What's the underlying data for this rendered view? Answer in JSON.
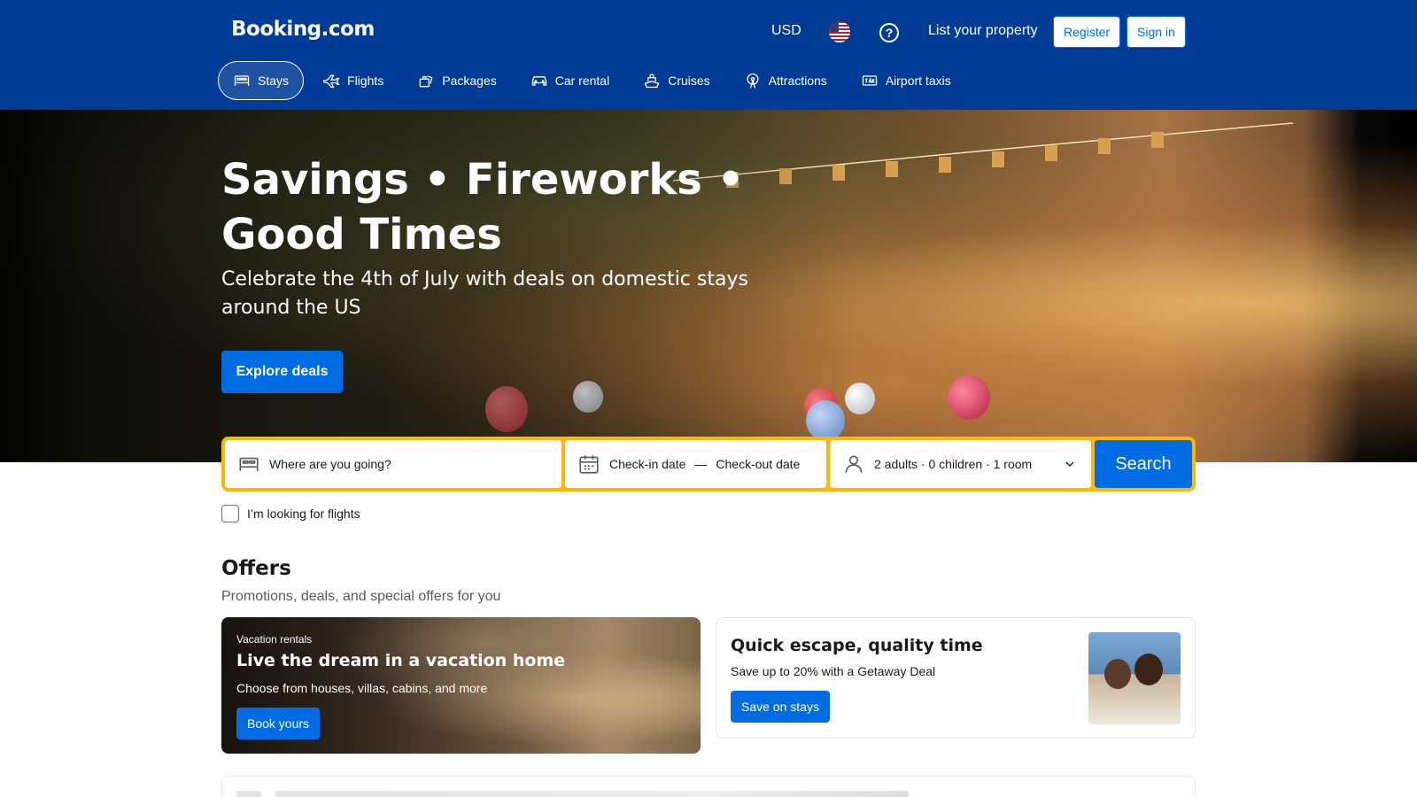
{
  "header": {
    "logo": "Booking.com",
    "currency": "USD",
    "list_property": "List your property",
    "register": "Register",
    "sign_in": "Sign in"
  },
  "nav": {
    "items": [
      {
        "label": "Stays",
        "icon": "bed-icon",
        "active": true
      },
      {
        "label": "Flights",
        "icon": "plane-icon"
      },
      {
        "label": "Packages",
        "icon": "packages-icon"
      },
      {
        "label": "Car rental",
        "icon": "car-icon"
      },
      {
        "label": "Cruises",
        "icon": "ship-icon"
      },
      {
        "label": "Attractions",
        "icon": "ferris-wheel-icon"
      },
      {
        "label": "Airport taxis",
        "icon": "taxi-icon"
      }
    ]
  },
  "hero": {
    "title": "Savings • Fireworks • Good Times",
    "subtitle": "Celebrate the 4th of July with deals on domestic stays around the US",
    "cta": "Explore deals"
  },
  "search": {
    "destination_placeholder": "Where are you going?",
    "checkin": "Check-in date",
    "separator": "—",
    "checkout": "Check-out date",
    "guests": "2 adults · 0 children · 1 room",
    "button": "Search"
  },
  "flights_checkbox": "I’m looking for flights",
  "offers": {
    "title": "Offers",
    "subtitle": "Promotions, deals, and special offers for you",
    "cards": [
      {
        "kicker": "Vacation rentals",
        "title": "Live the dream in a vacation home",
        "description": "Choose from houses, villas, cabins, and more",
        "button": "Book yours"
      },
      {
        "title": "Quick escape, quality time",
        "description": "Save up to 20% with a Getaway Deal",
        "button": "Save on stays"
      }
    ]
  },
  "colors": {
    "header_bg": "#003b95",
    "primary_button": "#006ce4",
    "search_border": "#ffb700"
  }
}
